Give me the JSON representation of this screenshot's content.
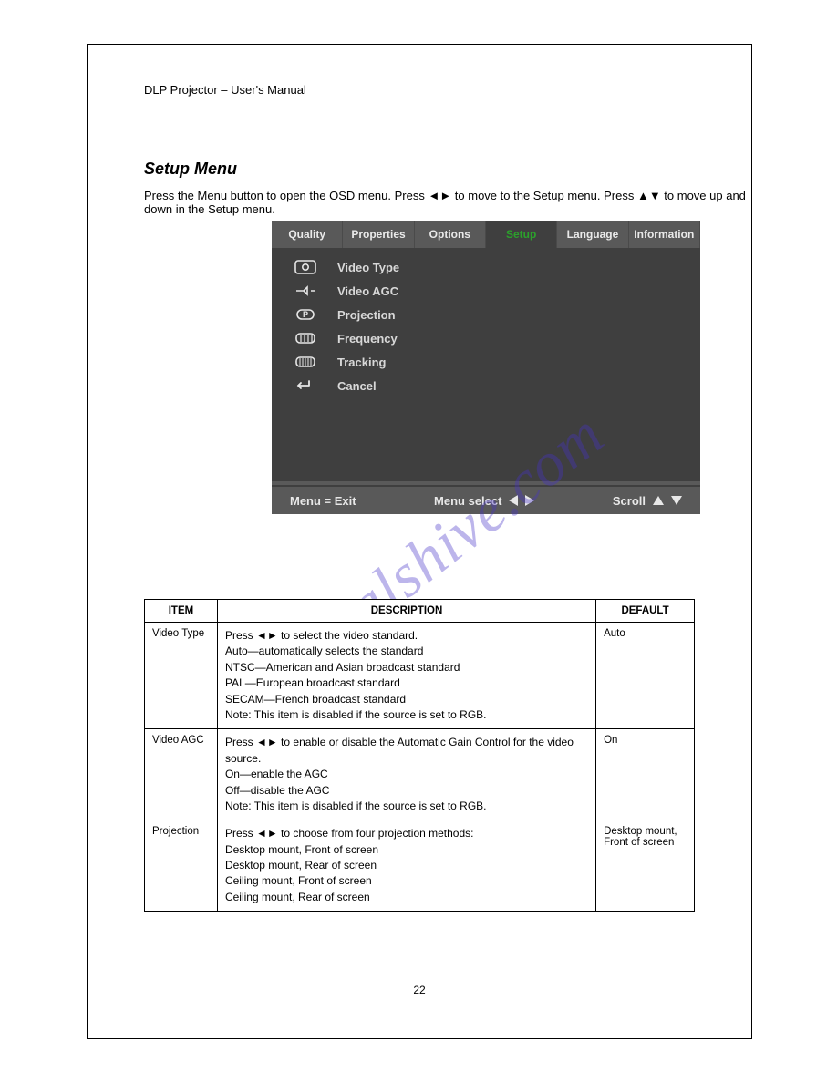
{
  "header": {
    "left": "DLP Projector – User's Manual",
    "right": ""
  },
  "section": {
    "heading": "Setup Menu",
    "desc": "Press the Menu button to open the OSD menu. Press ◄► to move to the Setup menu. Press ▲▼ to move up and down in the Setup menu."
  },
  "osd": {
    "tabs": [
      "Quality",
      "Properties",
      "Options",
      "Setup",
      "Language",
      "Information"
    ],
    "active_tab": "Setup",
    "items": [
      {
        "icon": "video-type-icon",
        "label": "Video Type"
      },
      {
        "icon": "video-agc-icon",
        "label": "Video AGC"
      },
      {
        "icon": "projection-icon",
        "label": "Projection"
      },
      {
        "icon": "frequency-icon",
        "label": "Frequency"
      },
      {
        "icon": "tracking-icon",
        "label": "Tracking"
      },
      {
        "icon": "cancel-icon",
        "label": "Cancel"
      }
    ],
    "footer": {
      "left": "Menu = Exit",
      "mid": "Menu select",
      "right": "Scroll"
    }
  },
  "watermark": "manualshive.com",
  "table": {
    "head": [
      "ITEM",
      "DESCRIPTION",
      "DEFAULT"
    ],
    "rows": [
      {
        "item": "Video Type",
        "desc": "Press ◄► to select the video standard.\nAuto—automatically selects the standard\nNTSC—American and Asian broadcast standard\nPAL—European broadcast standard\nSECAM—French broadcast standard\nNote: This item is disabled if the source is set to RGB.",
        "def": "Auto"
      },
      {
        "item": "Video AGC",
        "desc": "Press ◄► to enable or disable the Automatic Gain Control for the video source.\nOn—enable the AGC\nOff—disable the AGC\nNote: This item is disabled if the source is set to RGB.",
        "def": "On"
      },
      {
        "item": "Projection",
        "desc": "Press ◄► to choose from four projection methods:\nDesktop mount, Front of screen\nDesktop mount, Rear of screen\nCeiling mount, Front of screen\nCeiling mount, Rear of screen",
        "def": "Desktop mount, Front of screen"
      }
    ]
  },
  "page_number": "22"
}
